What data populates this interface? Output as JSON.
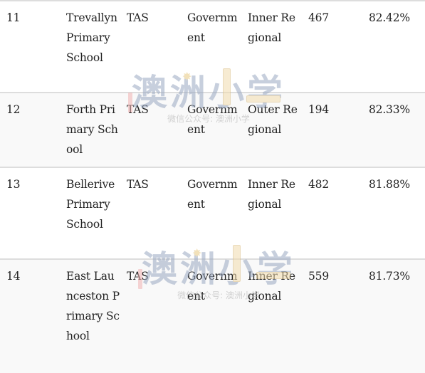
{
  "table": {
    "rows": [
      {
        "rank": "11",
        "school": "Trevallyn Primary School",
        "state": "TAS",
        "sector": "Government",
        "geolocation": "Inner Regional",
        "enrolments": "467",
        "score": "82.42%"
      },
      {
        "rank": "12",
        "school": "Forth Primary School",
        "state": "TAS",
        "sector": "Government",
        "geolocation": "Outer Regional",
        "enrolments": "194",
        "score": "82.33%"
      },
      {
        "rank": "13",
        "school": "Bellerive Primary School",
        "state": "TAS",
        "sector": "Government",
        "geolocation": "Inner Regional",
        "enrolments": "482",
        "score": "81.88%"
      },
      {
        "rank": "14",
        "school": "East Launceston Primary School",
        "state": "TAS",
        "sector": "Government",
        "geolocation": "Inner Regional",
        "enrolments": "559",
        "score": "81.73%"
      }
    ]
  },
  "watermark": {
    "title": "澳洲小学",
    "subtitle": "微信公众号: 澳洲小学",
    "color": "#9aa9c2"
  }
}
